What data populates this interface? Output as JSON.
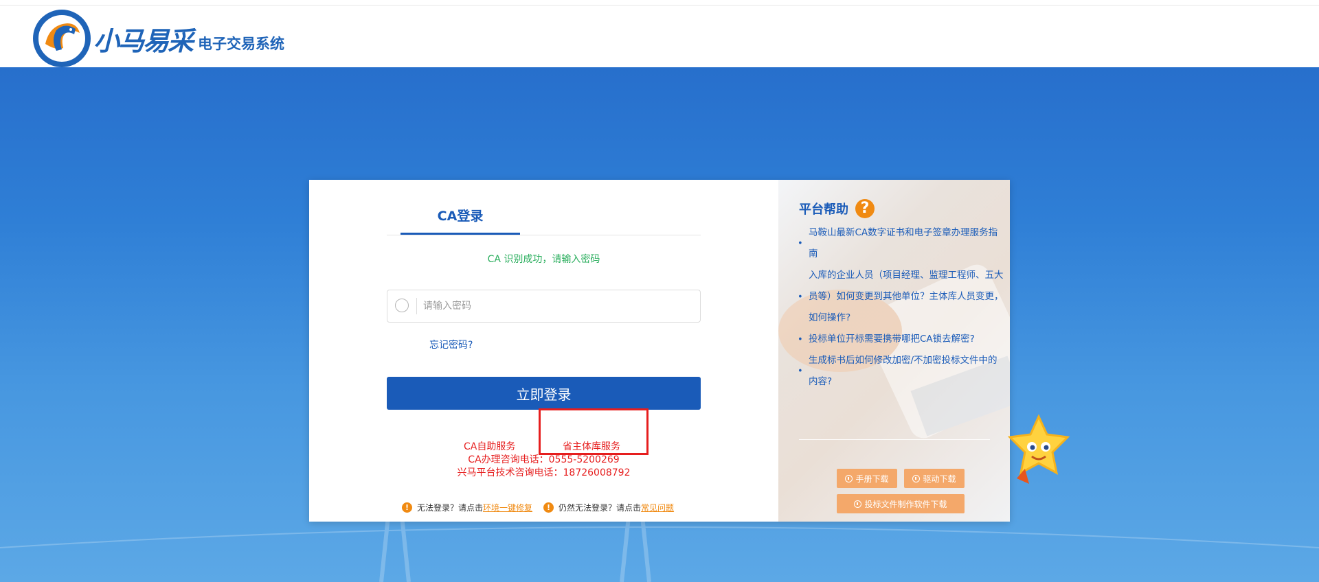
{
  "header": {
    "logo_main": "小马易采",
    "logo_sub": "电子交易系统"
  },
  "login": {
    "tab_ca": "CA登录",
    "ca_status": "CA 识别成功，请输入密码",
    "password_placeholder": "请输入密码",
    "forgot_password": "忘记密码?",
    "login_button": "立即登录",
    "service_ca_self": "CA自助服务",
    "service_province": "省主体库服务",
    "phone_ca": "CA办理咨询电话：0555-5200269",
    "phone_platform": "兴马平台技术咨询电话：18726008792",
    "hint1_prefix": "无法登录？请点击",
    "hint1_link": "环境一键修复",
    "hint2_prefix": "仍然无法登录？请点击",
    "hint2_link": "常见问题",
    "warn_symbol": "!"
  },
  "help": {
    "title": "平台帮助",
    "icon_symbol": "?",
    "items": [
      "马鞍山最新CA数字证书和电子签章办理服务指南",
      "入库的企业人员（项目经理、监理工程师、五大员等）如何变更到其他单位？主体库人员变更，如何操作?",
      "投标单位开标需要携带哪把CA锁去解密?",
      "生成标书后如何修改加密/不加密投标文件中的内容?"
    ],
    "btn_manual": "手册下载",
    "btn_driver": "驱动下载",
    "btn_software": "投标文件制作软件下载"
  },
  "colors": {
    "brand_blue": "#1a5bb8",
    "success_green": "#2aae5d",
    "alert_red": "#e61e1e",
    "accent_orange": "#f08a12",
    "download_orange": "#f4a86a"
  }
}
